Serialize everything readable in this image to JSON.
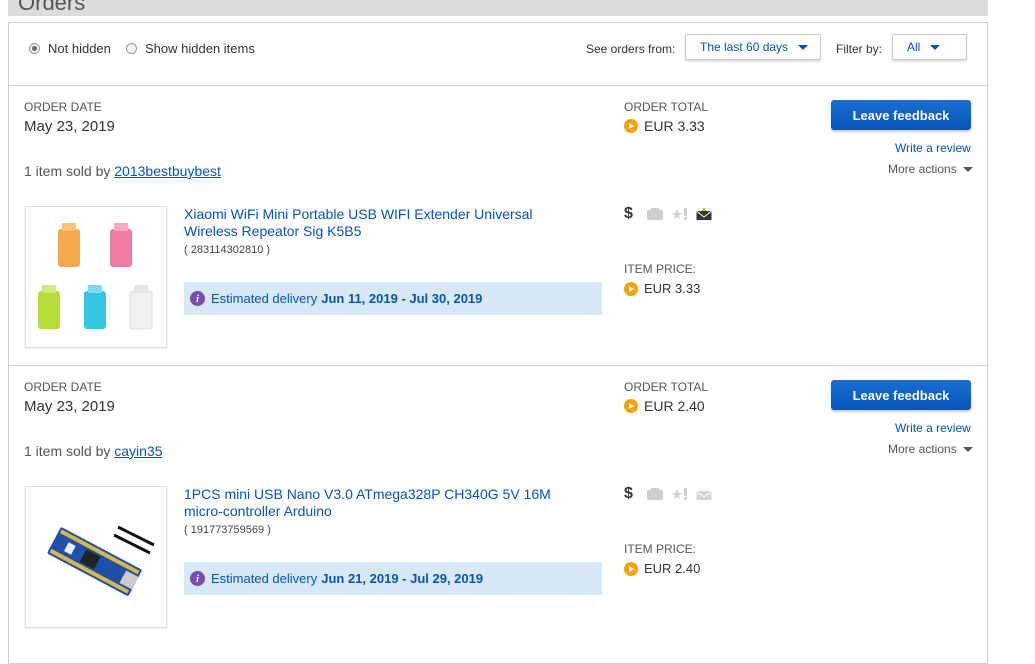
{
  "page": {
    "title": "Orders"
  },
  "filters": {
    "not_hidden": "Not hidden",
    "show_hidden": "Show hidden items",
    "see_orders_from_label": "See orders from:",
    "see_orders_from_value": "The last 60 days",
    "filter_by_label": "Filter by:",
    "filter_by_value": "All"
  },
  "labels": {
    "order_date": "ORDER DATE",
    "order_total": "ORDER TOTAL",
    "item_price": "ITEM PRICE:",
    "leave_feedback": "Leave feedback",
    "write_review": "Write a review",
    "more_actions": "More actions",
    "estimated_delivery": "Estimated delivery",
    "sold_by_prefix": "1 item sold by"
  },
  "orders": [
    {
      "date": "May 23, 2019",
      "total": "EUR 3.33",
      "seller": "2013bestbuybest",
      "item_title": "Xiaomi WiFi Mini Portable USB WIFI Extender Universal Wireless Repeator Sig K5B5",
      "item_number": "( 283114302810 )",
      "item_price": "EUR 3.33",
      "delivery": "Jun 11, 2019 - Jul 30, 2019"
    },
    {
      "date": "May 23, 2019",
      "total": "EUR 2.40",
      "seller": "cayin35",
      "item_title": "1PCS mini USB Nano V3.0 ATmega328P CH340G 5V 16M micro-controller Arduino",
      "item_number": "( 191773759569 )",
      "item_price": "EUR 2.40",
      "delivery": "Jun 21, 2019 - Jul 29, 2019"
    }
  ],
  "colors": {
    "link": "#0654ba",
    "button": "#0654ba",
    "delivery_bg": "#d6e9f5",
    "coin": "#f5a10a",
    "info": "#7a4ab5"
  }
}
